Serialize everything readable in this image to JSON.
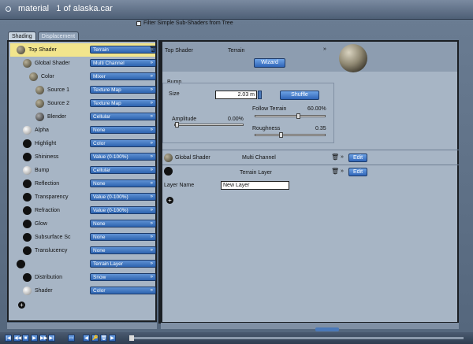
{
  "window": {
    "title": "material   1 of alaska.car"
  },
  "filter": {
    "label": "Filter Simple Sub-Shaders from Tree",
    "checked": false
  },
  "tabs": [
    {
      "label": "Shading",
      "active": true
    },
    {
      "label": "Displacement",
      "active": false
    }
  ],
  "tree": [
    {
      "label": "Top Shader",
      "value": "Terrain",
      "ball": "tex",
      "highlight": true
    },
    {
      "label": "Global Shader",
      "value": "Multi Channel",
      "ball": "tex"
    },
    {
      "label": "Color",
      "value": "Mixer",
      "ball": "tex"
    },
    {
      "label": "Source 1",
      "value": "Texture Map",
      "ball": "tex"
    },
    {
      "label": "Source 2",
      "value": "Texture Map",
      "ball": "tex"
    },
    {
      "label": "Blender",
      "value": "Cellular",
      "ball": "grad"
    },
    {
      "label": "Alpha",
      "value": "None",
      "ball": "white"
    },
    {
      "label": "Highlight",
      "value": "Color",
      "ball": "black"
    },
    {
      "label": "Shininess",
      "value": "Value (0-100%)",
      "ball": "black"
    },
    {
      "label": "Bump",
      "value": "Cellular",
      "ball": "white"
    },
    {
      "label": "Reflection",
      "value": "None",
      "ball": "black"
    },
    {
      "label": "Transparency",
      "value": "Value (0-100%)",
      "ball": "black"
    },
    {
      "label": "Refraction",
      "value": "Value (0-100%)",
      "ball": "black"
    },
    {
      "label": "Glow",
      "value": "None",
      "ball": "black"
    },
    {
      "label": "Subsurface Sc",
      "value": "None",
      "ball": "black"
    },
    {
      "label": "Translucency",
      "value": "None",
      "ball": "black"
    },
    {
      "label": "",
      "value": "Terrain Layer",
      "ball": "black"
    },
    {
      "label": "Distribution",
      "value": "Snow",
      "ball": "black"
    },
    {
      "label": "Shader",
      "value": "Color",
      "ball": "white"
    }
  ],
  "right": {
    "top_shader_label": "Top Shader",
    "top_shader_value": "Terrain",
    "wizard": "Wizard",
    "bump_group": "Bump",
    "size_label": "Size",
    "size_value": "2.03 m",
    "shuffle": "Shuffle",
    "follow_terrain_label": "Follow Terrain",
    "follow_terrain_value": "60.00%",
    "amplitude_label": "Amplitude",
    "amplitude_value": "0.00%",
    "roughness_label": "Roughness",
    "roughness_value": "0.35",
    "global_shader_label": "Global Shader",
    "global_shader_value": "Multi Channel",
    "edit1": "Edit",
    "terrain_layer_label": "Terrain Layer",
    "edit2": "Edit",
    "layer_name_label": "Layer Name",
    "layer_name_value": "New Layer"
  },
  "toolbar": {
    "icons": [
      "first-frame-icon",
      "prev-frame-icon",
      "stop-icon",
      "play-icon",
      "next-frame-icon",
      "last-frame-icon",
      "record-icon",
      "key-back-icon",
      "key-add-icon",
      "key-delete-icon",
      "key-forward-icon"
    ]
  }
}
